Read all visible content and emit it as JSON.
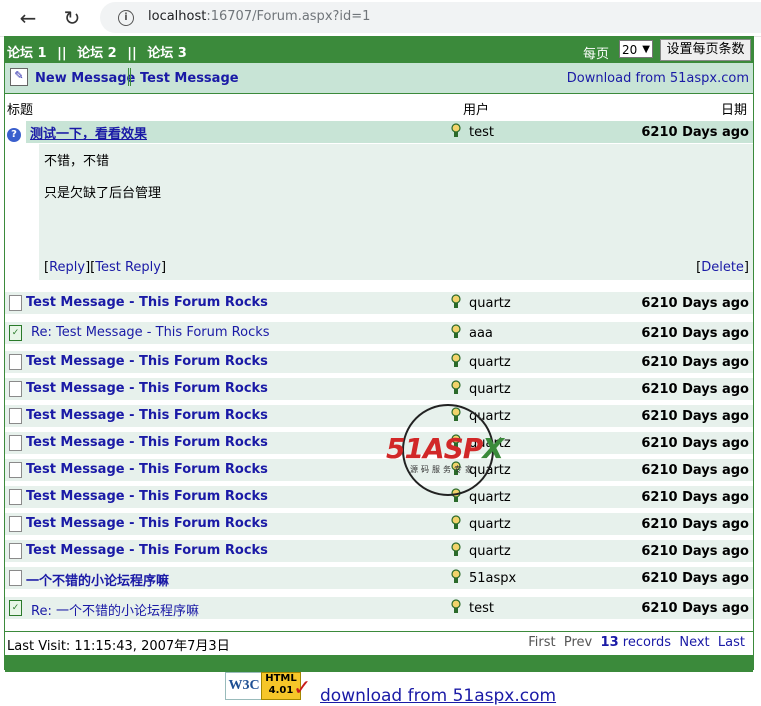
{
  "browser": {
    "url_host": "localhost",
    "url_rest": ":16707/Forum.aspx?id=1"
  },
  "forum_bar": {
    "forums": [
      "论坛 1",
      "论坛 2",
      "论坛 3"
    ],
    "separator": "||",
    "per_page_label": "每页",
    "per_page_value": "20",
    "set_button": "设置每页条数"
  },
  "action_bar": {
    "new_message": "New Message",
    "test_message": "Test Message",
    "download": "Download from 51aspx.com"
  },
  "columns": {
    "title": "标题",
    "user": "用户",
    "date": "日期"
  },
  "expanded": {
    "title": "测试一下，看看效果",
    "user": "test",
    "days": "6210 Days ago",
    "body_line1": "不错，不错",
    "body_line2": "只是欠缺了后台管理",
    "reply": "Reply",
    "test_reply": "Test Reply",
    "delete": "Delete"
  },
  "rows": [
    {
      "title": "Test Message - This Forum Rocks",
      "user": "quartz",
      "days": "6210 Days ago",
      "reply": false
    },
    {
      "title": "Re: Test Message - This Forum Rocks",
      "user": "aaa",
      "days": "6210 Days ago",
      "reply": true
    },
    {
      "title": "Test Message - This Forum Rocks",
      "user": "quartz",
      "days": "6210 Days ago",
      "reply": false
    },
    {
      "title": "Test Message - This Forum Rocks",
      "user": "quartz",
      "days": "6210 Days ago",
      "reply": false
    },
    {
      "title": "Test Message - This Forum Rocks",
      "user": "quartz",
      "days": "6210 Days ago",
      "reply": false
    },
    {
      "title": "Test Message - This Forum Rocks",
      "user": "quartz",
      "days": "6210 Days ago",
      "reply": false
    },
    {
      "title": "Test Message - This Forum Rocks",
      "user": "quartz",
      "days": "6210 Days ago",
      "reply": false
    },
    {
      "title": "Test Message - This Forum Rocks",
      "user": "quartz",
      "days": "6210 Days ago",
      "reply": false
    },
    {
      "title": "Test Message - This Forum Rocks",
      "user": "quartz",
      "days": "6210 Days ago",
      "reply": false
    },
    {
      "title": "Test Message - This Forum Rocks",
      "user": "quartz",
      "days": "6210 Days ago",
      "reply": false
    },
    {
      "title": "一个不错的小论坛程序嘛",
      "user": "51aspx",
      "days": "6210 Days ago",
      "reply": false
    },
    {
      "title": "Re: 一个不错的小论坛程序嘛",
      "user": "test",
      "days": "6210 Days ago",
      "reply": true
    }
  ],
  "footer": {
    "last_visit": "Last Visit: 11:15:43, 2007年7月3日",
    "first": "First",
    "prev": "Prev",
    "records_count": "13",
    "records_label": "records",
    "next": "Next",
    "last": "Last"
  },
  "bottom": {
    "w3c": "W3C",
    "html_badge_1": "HTML",
    "html_badge_2": "4.01",
    "link": "download from 51aspx.com"
  },
  "watermark": {
    "text_a": "51",
    "text_b": "ASP",
    "text_c": "X",
    "sub": "源码服务专家"
  }
}
